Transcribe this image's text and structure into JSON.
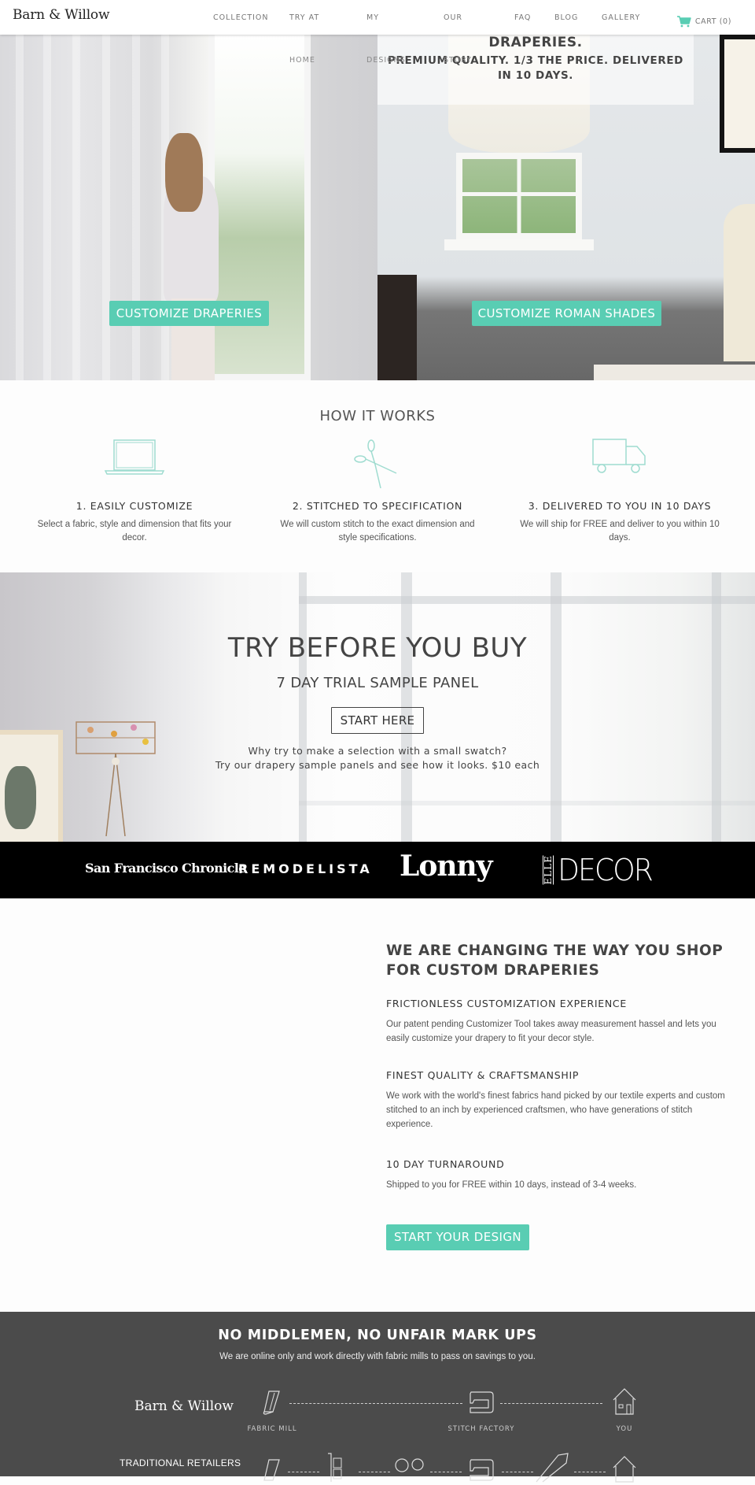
{
  "header": {
    "logo": "Barn & Willow",
    "nav": [
      {
        "label": "COLLECTION"
      },
      {
        "label": "TRY AT",
        "sub": "HOME"
      },
      {
        "label": "MY",
        "sub": "DESIGNS"
      },
      {
        "label": "OUR",
        "sub": "STORY"
      },
      {
        "label": "FAQ"
      },
      {
        "label": "BLOG"
      },
      {
        "label": "GALLERY"
      }
    ],
    "cart_label": "CART (0)",
    "cart_icon": "shopping-cart-icon"
  },
  "colors": {
    "accent": "#59cdb3",
    "dark_band": "#4b4b4b",
    "press_band": "#000000",
    "text": "#444444"
  },
  "hero": {
    "title": "DRAPERIES.",
    "subtitle": "PREMIUM QUALITY. 1/3 THE PRICE. DELIVERED IN 10 DAYS.",
    "left_button": "CUSTOMIZE DRAPERIES",
    "right_button": "CUSTOMIZE ROMAN SHADES"
  },
  "how_it_works": {
    "title": "HOW IT WORKS",
    "steps": [
      {
        "icon": "laptop-icon",
        "title": "1. EASILY CUSTOMIZE",
        "desc": "Select a fabric, style and dimension that fits your decor."
      },
      {
        "icon": "scissors-icon",
        "title": "2. STITCHED TO SPECIFICATION",
        "desc": "We will custom stitch to the exact dimension and style specifications."
      },
      {
        "icon": "truck-icon",
        "title": "3. DELIVERED TO YOU IN 10 DAYS",
        "desc": "We will ship for FREE and deliver to you within 10 days."
      }
    ]
  },
  "try_before": {
    "title": "TRY BEFORE YOU BUY",
    "subtitle": "7 DAY TRIAL SAMPLE PANEL",
    "button": "START HERE",
    "line1": "Why try to make a selection with a small swatch?",
    "line2": "Try our drapery sample panels and see how it looks.  $10 each"
  },
  "press": {
    "logos": [
      "San Francisco Chronicle",
      "REMODELISTA",
      "Lonny",
      "ELLE",
      "DECOR"
    ]
  },
  "changing": {
    "title": "WE ARE CHANGING THE WAY YOU SHOP FOR CUSTOM DRAPERIES",
    "blocks": [
      {
        "heading": "FRICTIONLESS CUSTOMIZATION EXPERIENCE",
        "text": "Our patent pending Customizer Tool takes away measurement hassel and lets you easily customize your drapery to fit your decor style."
      },
      {
        "heading": "FINEST QUALITY & CRAFTSMANSHIP",
        "text": "We work with the world's finest fabrics hand picked by our textile experts and custom stitched to an inch by experienced craftsmen, who have generations of stitch experience."
      },
      {
        "heading": "10 DAY TURNAROUND",
        "text": "Shipped to you for FREE within 10 days, instead of 3-4 weeks."
      }
    ],
    "button": "START YOUR DESIGN"
  },
  "middlemen": {
    "title": "NO MIDDLEMEN, NO UNFAIR MARK UPS",
    "subtitle": "We are online only and work directly with fabric mills to pass on savings to you.",
    "brand": "Barn & Willow",
    "brand_chain": [
      {
        "icon": "fabric-roll-icon",
        "label": "FABRIC MILL"
      },
      {
        "icon": "sewing-machine-icon",
        "label": "STITCH FACTORY"
      },
      {
        "icon": "house-icon",
        "label": "YOU"
      }
    ],
    "traditional_label": "TRADITIONAL RETAILERS",
    "traditional_chain": [
      {
        "icon": "fabric-roll-icon"
      },
      {
        "icon": "hand-truck-icon"
      },
      {
        "icon": "people-icon"
      },
      {
        "icon": "sewing-machine-icon"
      },
      {
        "icon": "airplane-icon"
      },
      {
        "icon": "house-icon"
      }
    ]
  }
}
